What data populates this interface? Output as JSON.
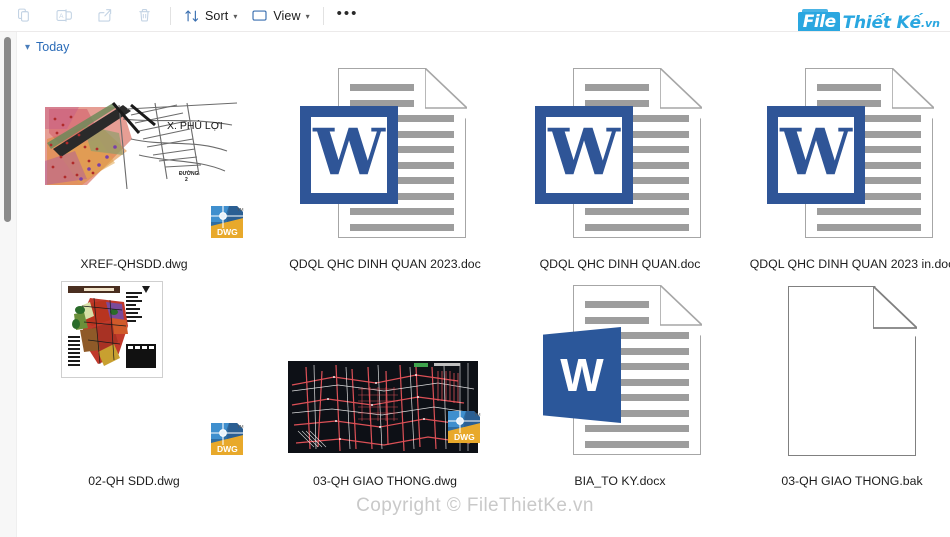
{
  "toolbar": {
    "buttons": [
      {
        "name": "copy-button",
        "icon": "copy-icon",
        "label": "",
        "enabled": false
      },
      {
        "name": "rename-button",
        "icon": "rename-icon",
        "label": "",
        "enabled": false
      },
      {
        "name": "share-button",
        "icon": "share-icon",
        "label": "",
        "enabled": false
      },
      {
        "name": "delete-button",
        "icon": "trash-icon",
        "label": "",
        "enabled": false
      }
    ],
    "sort_label": "Sort",
    "view_label": "View",
    "more_label": "•••"
  },
  "logo": {
    "part1": "File",
    "part2": "Thiết Kế",
    "part3": ".vn",
    "color": "#2aa7e0"
  },
  "group": {
    "chevron": "⌄",
    "title": "Today"
  },
  "files": [
    {
      "name": "XREF-QHSDD.dwg",
      "icon": "dwg-thumbnail",
      "thumb_label": "X. PHÚ LỢI",
      "badge": "DWG"
    },
    {
      "name": "QDQL QHC DINH QUAN 2023.doc",
      "icon": "word-doc-icon",
      "letter": "W"
    },
    {
      "name": "QDQL QHC DINH QUAN.doc",
      "icon": "word-doc-icon",
      "letter": "W"
    },
    {
      "name": "QDQL QHC DINH QUAN 2023 in.doc",
      "icon": "word-doc-icon",
      "letter": "W"
    },
    {
      "name": "02-QH SDD.dwg",
      "icon": "dwg-thumbnail",
      "badge": "DWG"
    },
    {
      "name": "03-QH GIAO THONG.dwg",
      "icon": "dwg-thumbnail-dark",
      "badge": "DWG"
    },
    {
      "name": "BIA_TO KY.docx",
      "icon": "word-docx-icon",
      "letter": "W"
    },
    {
      "name": "03-QH GIAO THONG.bak",
      "icon": "blank-file-icon"
    }
  ],
  "watermark": "Copyright © FileThietKe.vn"
}
